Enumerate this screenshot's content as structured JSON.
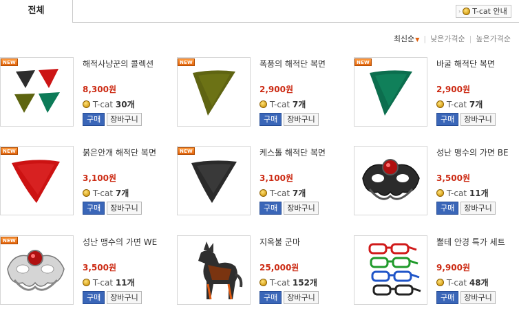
{
  "tabs": {
    "all_label": "전체"
  },
  "tcat_guide": {
    "label": "T-cat 안내"
  },
  "sort": {
    "options": [
      "최신순",
      "낮은가격순",
      "높은가격순"
    ]
  },
  "common": {
    "new_badge": "NEW",
    "buy_label": "구매",
    "cart_label": "장바구니",
    "currency_label": "T-cat"
  },
  "items": [
    {
      "name": "해적사냥꾼의 콜렉션",
      "price": "8,300원",
      "tcat": "30개",
      "new": true,
      "image": "bandana-set"
    },
    {
      "name": "폭풍의 해적단 복면",
      "price": "2,900원",
      "tcat": "7개",
      "new": true,
      "image": "bandana-olive"
    },
    {
      "name": "바굴 해적단 복면",
      "price": "2,900원",
      "tcat": "7개",
      "new": true,
      "image": "bandana-green"
    },
    {
      "name": "붉은안개 해적단 복면",
      "price": "3,100원",
      "tcat": "7개",
      "new": true,
      "image": "bandana-red"
    },
    {
      "name": "케스톨 해적단 복면",
      "price": "3,100원",
      "tcat": "7개",
      "new": true,
      "image": "bandana-black"
    },
    {
      "name": "성난 맹수의 가면 BE",
      "price": "3,500원",
      "tcat": "11개",
      "new": false,
      "image": "beast-mask-black"
    },
    {
      "name": "성난 맹수의 가면 WE",
      "price": "3,500원",
      "tcat": "11개",
      "new": true,
      "image": "beast-mask-white"
    },
    {
      "name": "지옥불 군마",
      "price": "25,000원",
      "tcat": "152개",
      "new": false,
      "image": "hellfire-horse"
    },
    {
      "name": "뽈테 안경 특가 세트",
      "price": "9,900원",
      "tcat": "48개",
      "new": false,
      "image": "glasses-set"
    }
  ]
}
